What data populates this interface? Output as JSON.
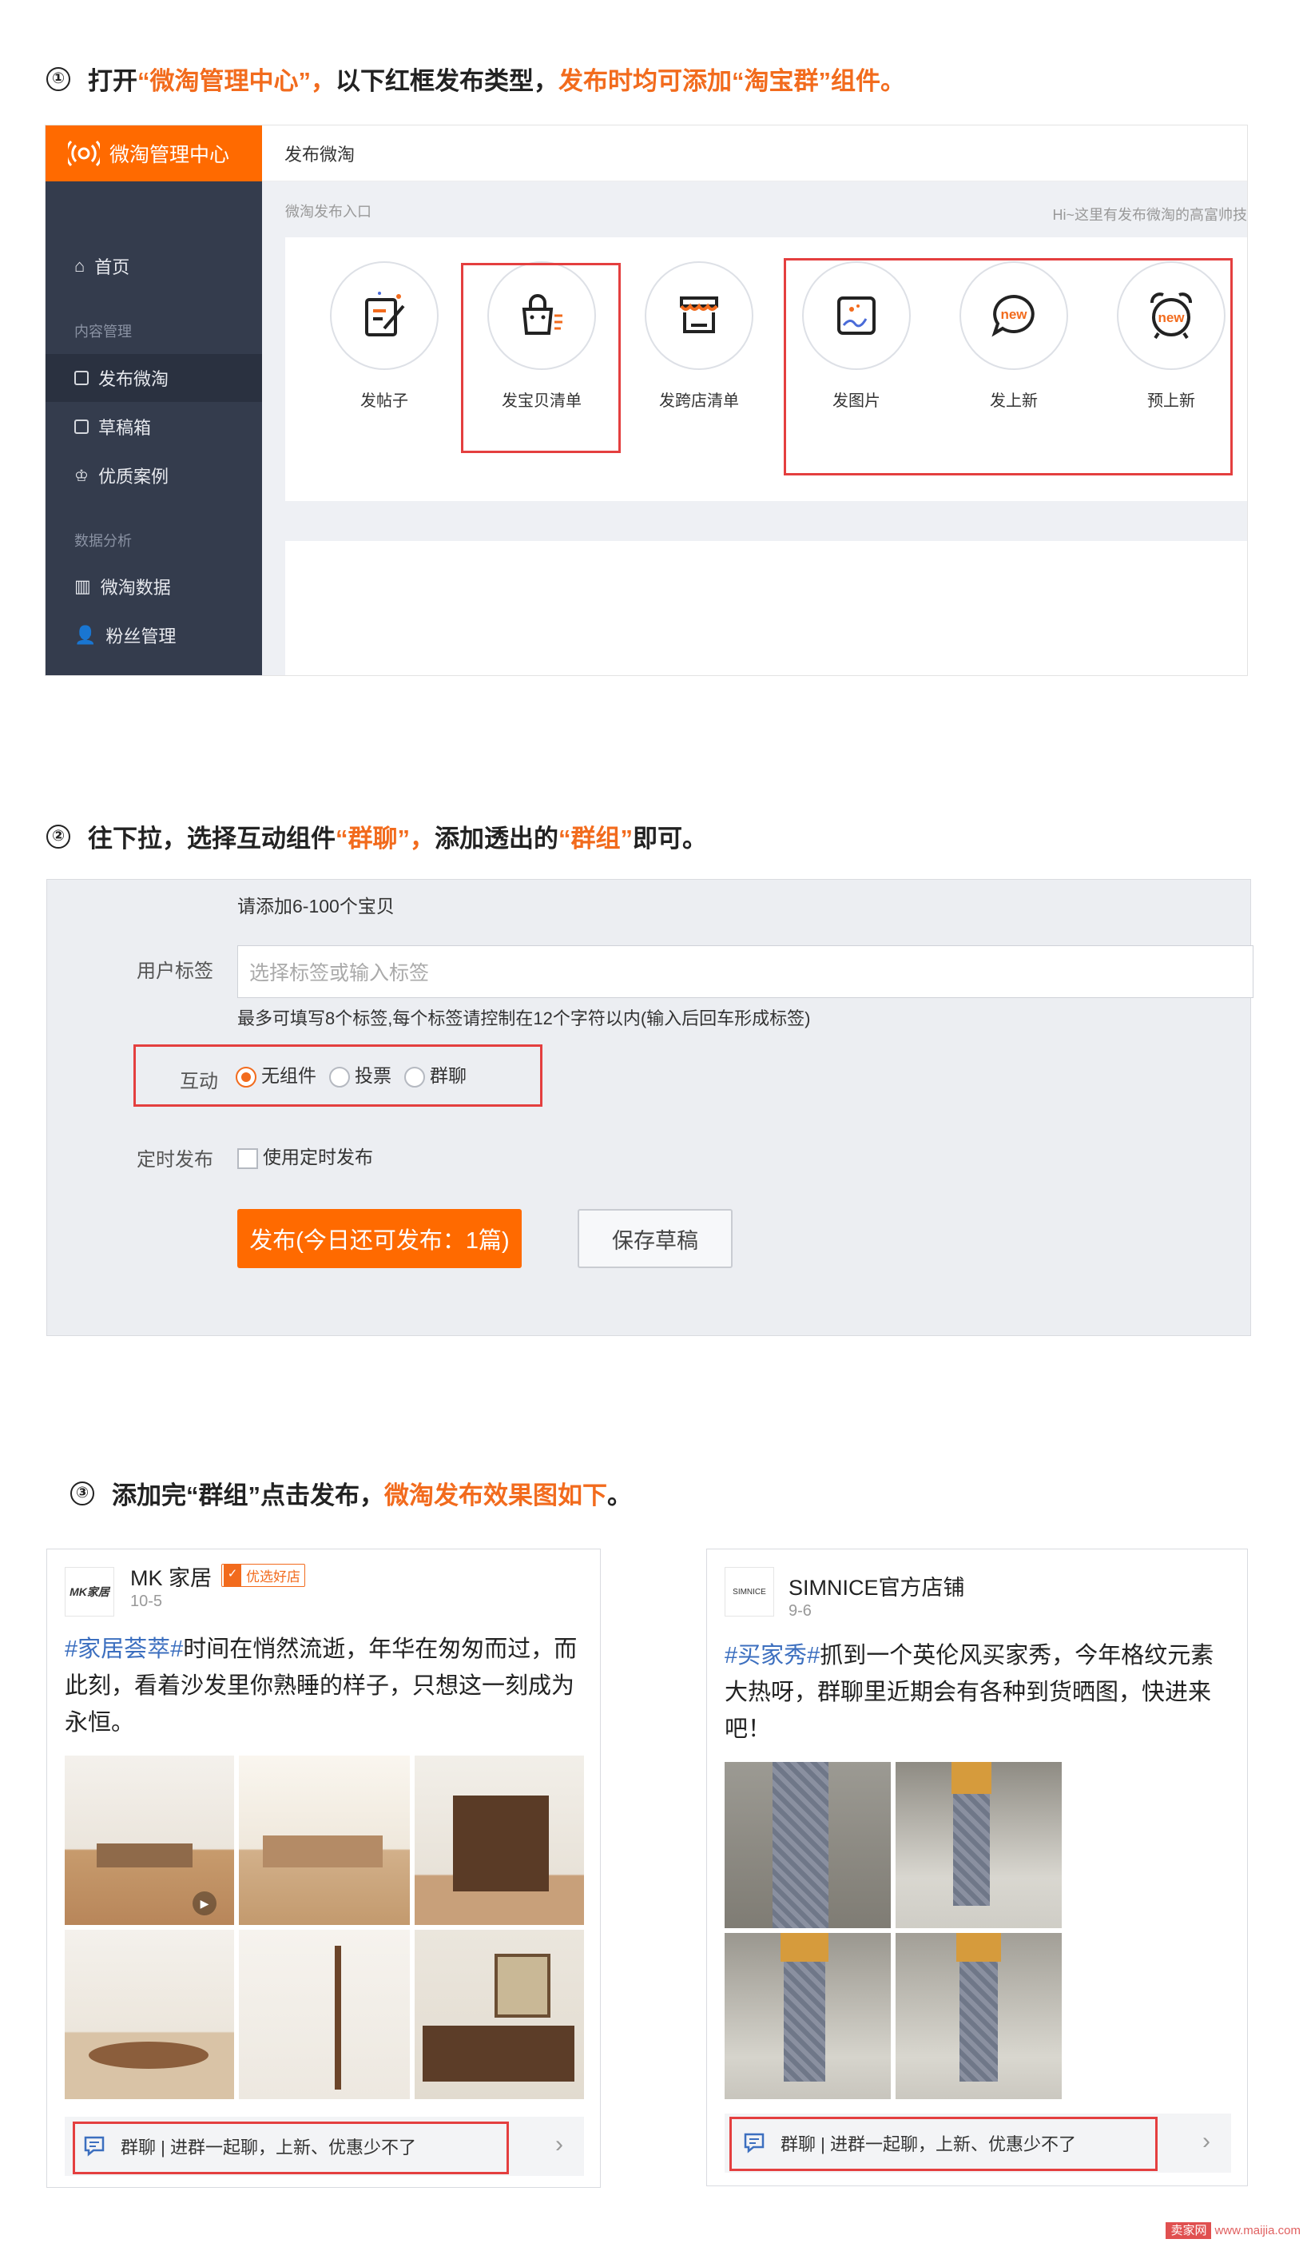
{
  "step1": {
    "num": "①",
    "p1": "打开",
    "p2": "“微淘管理中心”，",
    "p3": "以下红框发布类型，",
    "p4": "发布时均可添加“淘宝群”组件。"
  },
  "step2": {
    "num": "②",
    "p1": "往下拉，选择互动组件",
    "p2": "“群聊”，",
    "p3": "添加透出的",
    "p4": "“群组”",
    "p5": "即可。"
  },
  "step3": {
    "num": "③",
    "p1": "添加完“群组”点击发布，",
    "p2": "微淘发布效果图如下",
    "p3": "。"
  },
  "panel1": {
    "logo": "微淘管理中心",
    "topbar": "发布微淘",
    "entry_label": "微淘发布入口",
    "hint": "Hi~这里有发布微淘的高富帅技",
    "nav": {
      "home": "首页",
      "group_content": "内容管理",
      "publish": "发布微淘",
      "drafts": "草稿箱",
      "quality": "优质案例",
      "group_data": "数据分析",
      "data": "微淘数据",
      "fans": "粉丝管理"
    },
    "items": [
      "发帖子",
      "发宝贝清单",
      "发跨店清单",
      "发图片",
      "发上新",
      "预上新"
    ],
    "new_text": "new"
  },
  "panel2": {
    "add_items": "请添加6-100个宝贝",
    "tag_label": "用户标签",
    "tag_placeholder": "选择标签或输入标签",
    "tag_hint": "最多可填写8个标签,每个标签请控制在12个字符以内(输入后回车形成标签)",
    "interact_label": "互动",
    "options": [
      "无组件",
      "投票",
      "群聊"
    ],
    "schedule_label": "定时发布",
    "schedule_check": "使用定时发布",
    "publish_btn": "发布(今日还可发布：1篇)",
    "draft_btn": "保存草稿"
  },
  "post1": {
    "avatar": "MK家居",
    "name": "MK 家居",
    "badge": "优选好店",
    "date": "10-5",
    "tag": "#家居荟萃#",
    "text": "时间在悄然流逝，年华在匆匆而过，而此刻，看着沙发里你熟睡的样子，只想这一刻成为永恒。",
    "group": "群聊 | 进群一起聊，上新、优惠少不了"
  },
  "post2": {
    "avatar": "SIMNICE",
    "name": "SIMNICE官方店铺",
    "date": "9-6",
    "tag": "#买家秀#",
    "text": "抓到一个英伦风买家秀，今年格纹元素大热呀，群聊里近期会有各种到货晒图，快进来吧！",
    "group": "群聊 | 进群一起聊，上新、优惠少不了"
  },
  "watermark": {
    "badge": "卖家网",
    "url": "www.maijia.com"
  },
  "colors": {
    "accent": "#f26b1d",
    "brand": "#ff6a00",
    "sidebar": "#343c4d",
    "highlight_box": "#e43f3f",
    "hashtag": "#3c6fbf"
  }
}
